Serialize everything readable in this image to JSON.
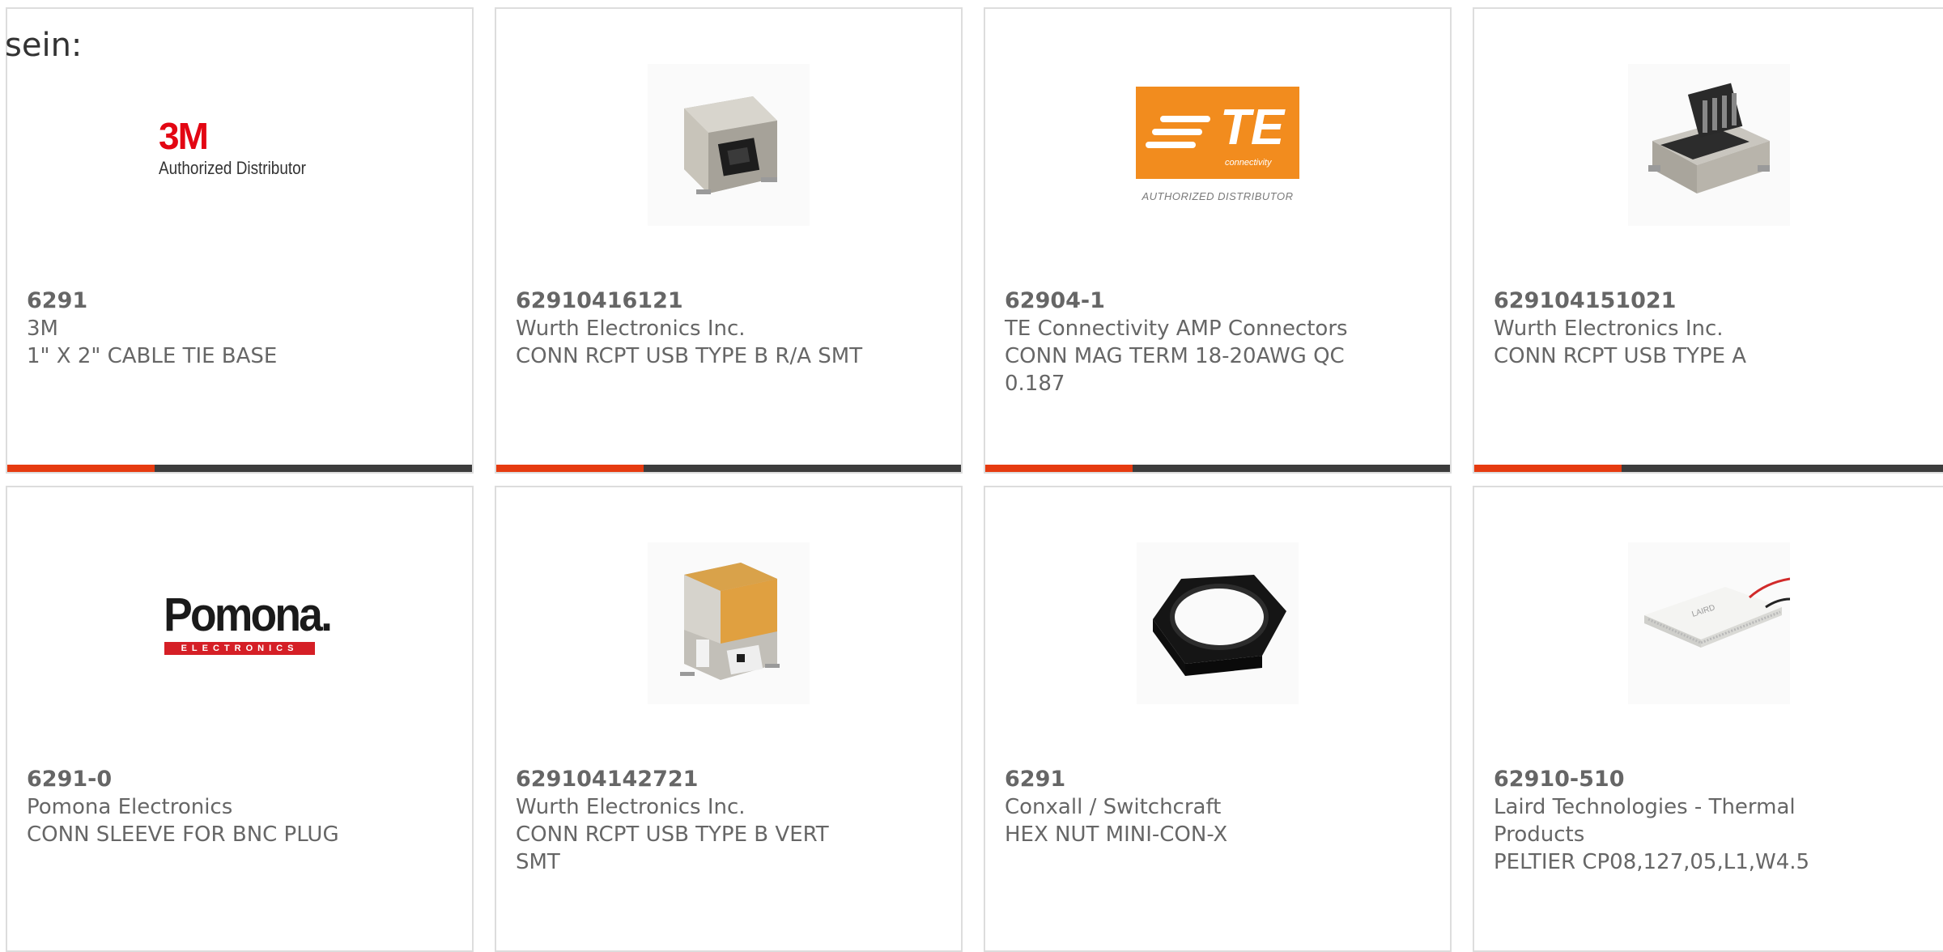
{
  "intro_text": "sein:",
  "products": [
    {
      "part_number": "6291",
      "manufacturer": "3M",
      "description": "1\" X 2\" CABLE TIE BASE",
      "image": "3m-authorized-distributor-logo",
      "logo_mark": "3M",
      "logo_caption": "Authorized Distributor"
    },
    {
      "part_number": "62910416121",
      "manufacturer": "Wurth Electronics Inc.",
      "description": "CONN RCPT USB TYPE B R/A SMT",
      "image": "usb-type-b-right-angle-connector-photo"
    },
    {
      "part_number": "62904-1",
      "manufacturer": "TE Connectivity AMP Connectors",
      "description": "CONN MAG TERM 18-20AWG QC 0.187",
      "image": "te-connectivity-authorized-distributor-logo",
      "logo_mark": "TE",
      "logo_sub": "connectivity",
      "logo_caption": "AUTHORIZED DISTRIBUTOR"
    },
    {
      "part_number": "629104151021",
      "manufacturer": "Wurth Electronics Inc.",
      "description": "CONN RCPT USB TYPE A",
      "image": "usb-type-a-receptacle-photo"
    },
    {
      "part_number": "6291-0",
      "manufacturer": "Pomona Electronics",
      "description": "CONN SLEEVE FOR BNC PLUG",
      "image": "pomona-electronics-logo",
      "logo_mark": "Pomona.",
      "logo_caption": "ELECTRONICS"
    },
    {
      "part_number": "629104142721",
      "manufacturer": "Wurth Electronics Inc.",
      "description": "CONN RCPT USB TYPE B VERT SMT",
      "image": "usb-type-b-vertical-connector-photo"
    },
    {
      "part_number": "6291",
      "manufacturer": "Conxall / Switchcraft",
      "description": "HEX NUT MINI-CON-X",
      "image": "black-hex-nut-photo"
    },
    {
      "part_number": "62910-510",
      "manufacturer": "Laird Technologies - Thermal Products",
      "description": "PELTIER CP08,127,05,L1,W4.5",
      "image": "peltier-module-photo"
    }
  ],
  "colors": {
    "accent": "#e63b10",
    "bar": "#3c3c3c",
    "border": "#dddddd",
    "text": "#666666",
    "te_orange": "#f28c1e",
    "pomona_red": "#d51f26",
    "brand_3m_red": "#e30613"
  }
}
